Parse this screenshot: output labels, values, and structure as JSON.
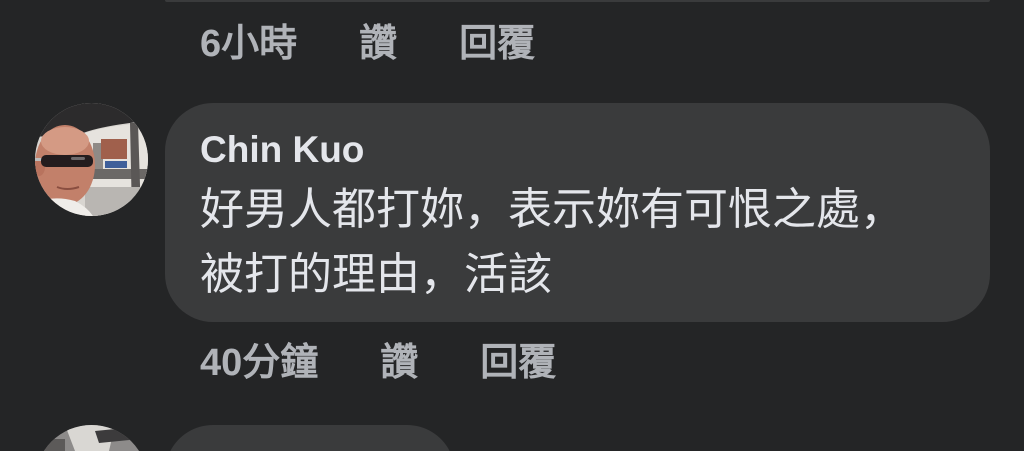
{
  "colors": {
    "page_background": "#242526",
    "bubble_background": "#3A3B3C",
    "primary_text": "#E4E6EB",
    "secondary_text": "#B0B3B8"
  },
  "previous_comment": {
    "actions": {
      "time": "6小時",
      "like": "讚",
      "reply": "回覆"
    }
  },
  "comment": {
    "author": "Chin Kuo",
    "text_lines": [
      "好男人都打妳，表示妳有可恨之處，",
      "被打的理由，活該"
    ],
    "actions": {
      "time": "40分鐘",
      "like": "讚",
      "reply": "回覆"
    }
  }
}
